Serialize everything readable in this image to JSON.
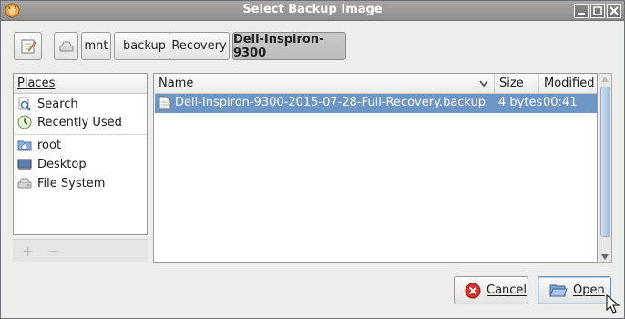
{
  "window": {
    "title": "Select Backup Image"
  },
  "pathbar": {
    "edit_icon": "pencil-note-icon",
    "drive_icon": "drive-icon",
    "segments": [
      "mnt",
      "backup",
      "Recovery",
      "Dell-Inspiron-9300"
    ],
    "active_index": 3
  },
  "places": {
    "header": "Places",
    "items": [
      {
        "label": "Search",
        "icon": "search-icon"
      },
      {
        "label": "Recently Used",
        "icon": "recent-icon"
      },
      {
        "label": "root",
        "icon": "home-folder-icon"
      },
      {
        "label": "Desktop",
        "icon": "desktop-icon"
      },
      {
        "label": "File System",
        "icon": "drive-icon"
      }
    ],
    "add_label": "+",
    "remove_label": "−"
  },
  "files": {
    "columns": {
      "name": "Name",
      "size": "Size",
      "modified": "Modified"
    },
    "rows": [
      {
        "name": "Dell-Inspiron-9300-2015-07-28-Full-Recovery.backup",
        "size": "4 bytes",
        "modified": "00:41",
        "selected": true
      }
    ]
  },
  "buttons": {
    "cancel": {
      "label": "Cancel",
      "mnemonic": "C"
    },
    "open": {
      "label": "Open",
      "mnemonic": "O"
    }
  },
  "colors": {
    "selection": "#6d95c6",
    "titlebar": "#9a9996"
  }
}
